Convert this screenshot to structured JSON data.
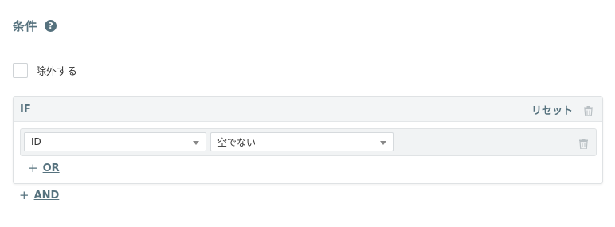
{
  "section": {
    "title": "条件",
    "help_icon": "question-circle-icon"
  },
  "exclude": {
    "label": "除外する",
    "checked": false
  },
  "if_block": {
    "label": "IF",
    "reset_label": "リセット",
    "conditions": [
      {
        "field": "ID",
        "operator": "空でない"
      }
    ],
    "add_or_label": "OR"
  },
  "add_and_label": "AND",
  "colors": {
    "accent": "#56727e",
    "trash": "#b9c0c4"
  }
}
